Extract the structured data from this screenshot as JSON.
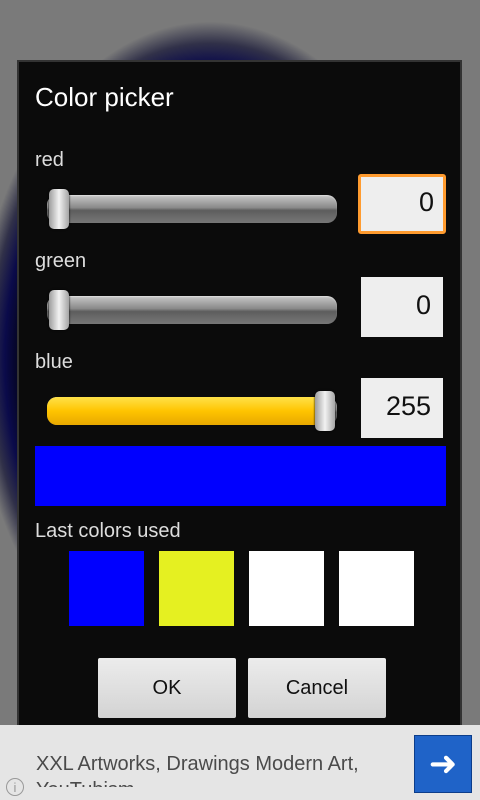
{
  "dialog": {
    "title": "Color picker",
    "red": {
      "label": "red",
      "value": "0",
      "slider_fraction": 0.0
    },
    "green": {
      "label": "green",
      "value": "0",
      "slider_fraction": 0.0
    },
    "blue": {
      "label": "blue",
      "value": "255",
      "slider_fraction": 1.0
    },
    "preview_color": "#0000ff",
    "last_colors_label": "Last colors used",
    "last_colors": [
      "#0000ff",
      "#e5f021",
      "#ffffff",
      "#ffffff"
    ],
    "ok_label": "OK",
    "cancel_label": "Cancel"
  },
  "ad": {
    "text": "XXL Artworks, Drawings Modern Art, YouTubism",
    "arrow_icon": "arrow-right-icon",
    "info_icon": "info-icon"
  },
  "colors": {
    "accent_focus": "#ff9b2f",
    "slider_fill": "#ffc400",
    "ad_button": "#1f63c8"
  }
}
